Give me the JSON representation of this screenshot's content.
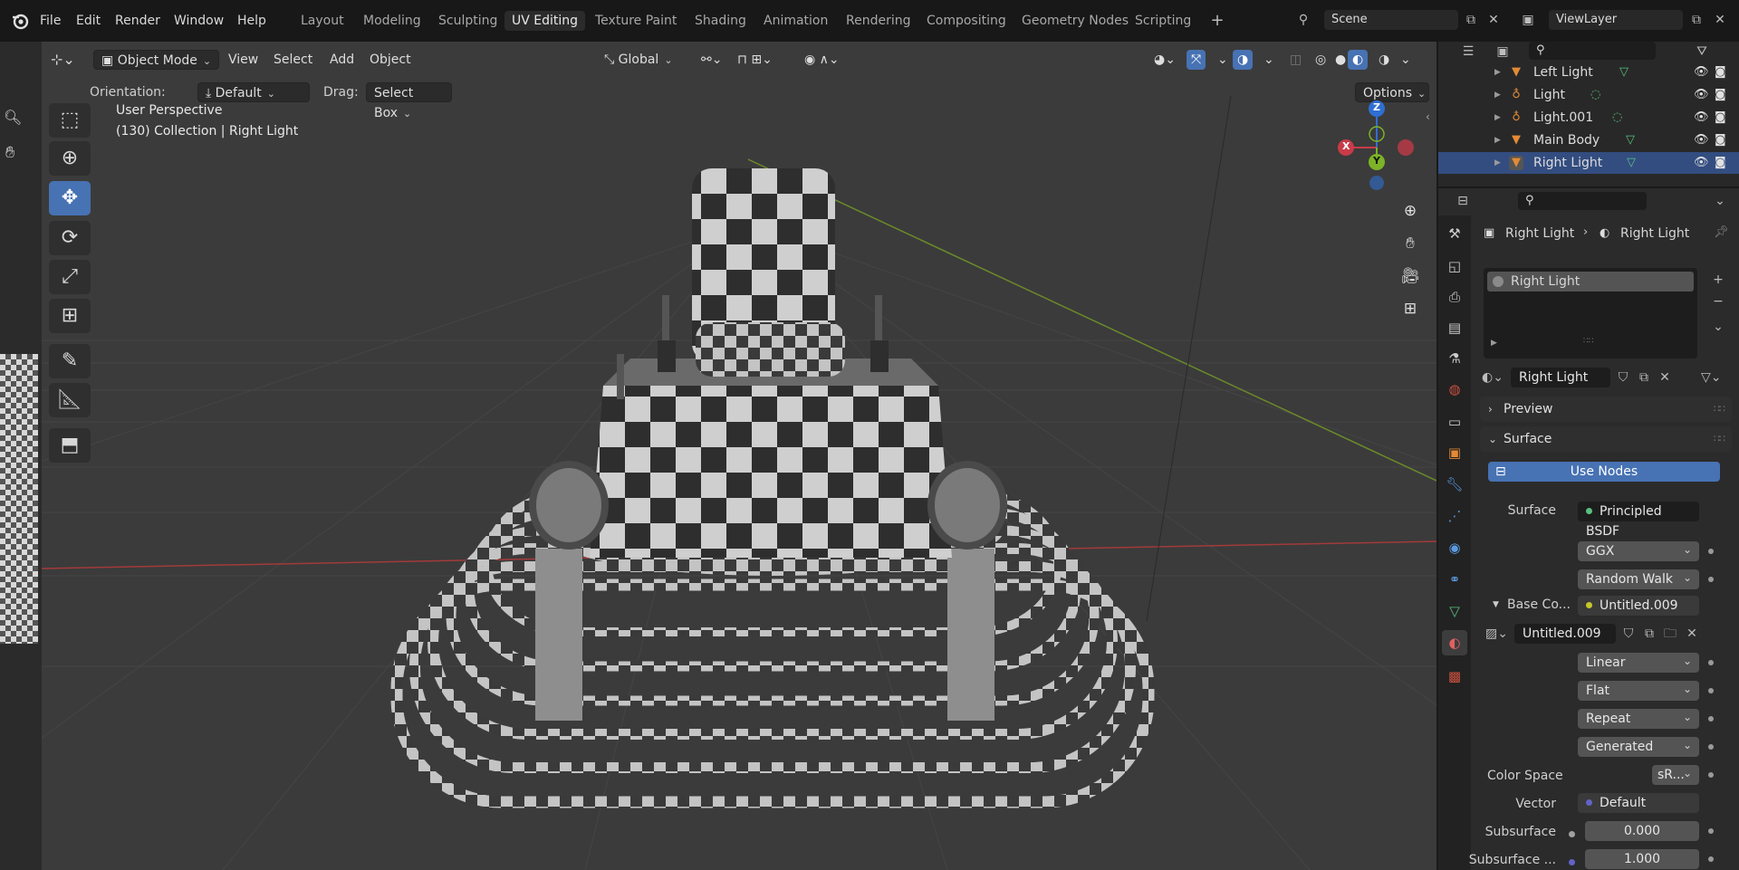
{
  "menus": [
    "File",
    "Edit",
    "Render",
    "Window",
    "Help"
  ],
  "workspaces": [
    "Layout",
    "Modeling",
    "Sculpting",
    "UV Editing",
    "Texture Paint",
    "Shading",
    "Animation",
    "Rendering",
    "Compositing",
    "Geometry Nodes",
    "Scripting"
  ],
  "active_workspace": "UV Editing",
  "scene": {
    "value": "Scene"
  },
  "view_layer": {
    "value": "ViewLayer"
  },
  "viewport_header": {
    "mode": "Object Mode",
    "menus": [
      "View",
      "Select",
      "Add",
      "Object"
    ],
    "orientation_global": "Global"
  },
  "tool_header": {
    "orientation_label": "Orientation:",
    "orientation_value": "Default",
    "drag_label": "Drag:",
    "drag_value": "Select Box",
    "options": "Options"
  },
  "overlay": {
    "view_name": "User Perspective",
    "collection_info": "(130) Collection | Right Light"
  },
  "gizmo": {
    "x": "X",
    "y": "Y",
    "z": "Z"
  },
  "outliner": {
    "items": [
      {
        "name": "Left Light",
        "icon": "mesh-icon"
      },
      {
        "name": "Light",
        "icon": "light-icon"
      },
      {
        "name": "Light.001",
        "icon": "light-icon"
      },
      {
        "name": "Main Body",
        "icon": "mesh-icon"
      },
      {
        "name": "Right Light",
        "icon": "mesh-icon"
      }
    ]
  },
  "properties": {
    "breadcrumb_object": "Right Light",
    "breadcrumb_material": "Right Light",
    "slot_name": "Right Light",
    "material_name": "Right Light",
    "panels": {
      "preview": "Preview",
      "surface": "Surface"
    },
    "use_nodes": "Use Nodes",
    "surface_label": "Surface",
    "surface_value": "Principled BSDF",
    "distribution": "GGX",
    "subsurface_method": "Random Walk",
    "base_color_label": "Base Co...",
    "base_color_value": "Untitled.009",
    "image_name": "Untitled.009",
    "interpolation": "Linear",
    "projection": "Flat",
    "extension": "Repeat",
    "source": "Generated",
    "color_space_label": "Color Space",
    "color_space_value": "sR...",
    "vector_label": "Vector",
    "vector_value": "Default",
    "subsurface_label": "Subsurface",
    "subsurface_value": "0.000",
    "subsurface_scale_label": "Subsurface ...",
    "subsurface_scale_value": "1.000"
  },
  "colors": {
    "accent": "#4772b3",
    "viewport_bg": "#3b3b3b",
    "axis_x": "#c93b48",
    "axis_y": "#7db326",
    "axis_z": "#2f6fd1",
    "mesh_icon": "#e38a36",
    "data_green": "#59c081"
  }
}
